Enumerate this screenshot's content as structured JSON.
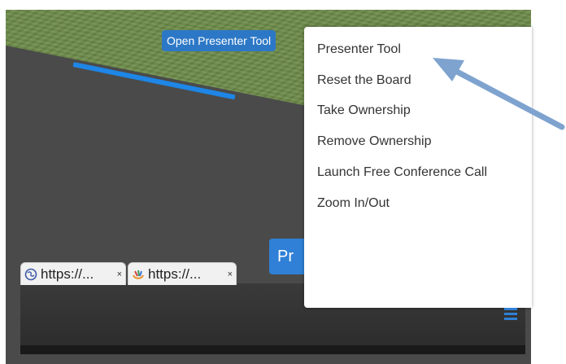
{
  "tooltip": {
    "label": "Open Presenter Tool"
  },
  "presenter_button": {
    "label": "Pr"
  },
  "tabs": [
    {
      "label": "https://...",
      "close": "×",
      "icon": "globe-icon"
    },
    {
      "label": "https://...",
      "close": "×",
      "icon": "app-logo-icon"
    }
  ],
  "menu": {
    "items": [
      {
        "label": "Presenter Tool"
      },
      {
        "label": "Reset the Board"
      },
      {
        "label": "Take Ownership"
      },
      {
        "label": "Remove Ownership"
      },
      {
        "label": "Launch Free Conference Call"
      },
      {
        "label": "Zoom In/Out"
      }
    ]
  },
  "colors": {
    "accent": "#2f80d6",
    "annotation_arrow": "#7fa3cf",
    "road_line": "#1e86e6",
    "grass": "#6e8c4a"
  },
  "icons": {
    "menu_toggle": "hamburger-icon"
  }
}
